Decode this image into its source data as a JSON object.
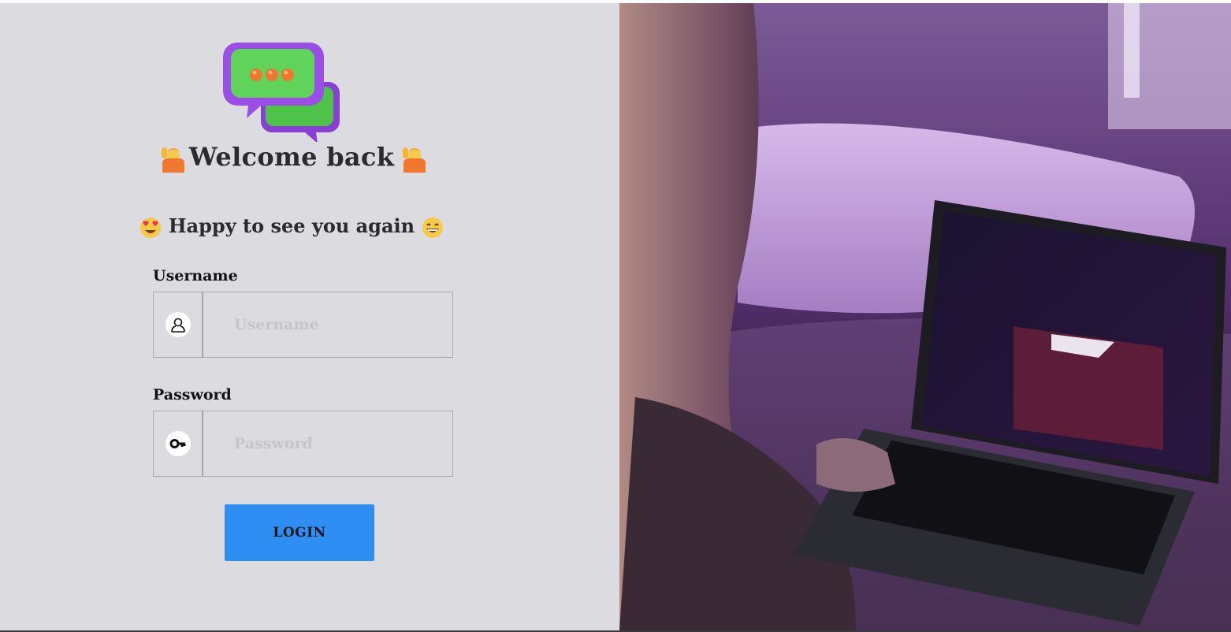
{
  "login": {
    "welcome_title": "Welcome back",
    "subtitle": "Happy to see you again",
    "username_label": "Username",
    "username_placeholder": "Username",
    "username_value": "",
    "password_label": "Password",
    "password_placeholder": "Password",
    "password_value": "",
    "login_button": "LOGIN"
  },
  "icons": {
    "logo": "chat-bubbles-icon",
    "welcome_left": "person-raising-hand-icon",
    "welcome_right": "person-raising-hand-icon",
    "subtitle_left": "heart-eyes-face-icon",
    "subtitle_right": "grinning-face-icon",
    "username": "user-icon",
    "password": "key-icon"
  },
  "colors": {
    "left_background": "#dcdbdf",
    "login_button": "#2f8ef4",
    "logo_bubble": "#9b4ee6",
    "logo_screen": "#5fd35a",
    "logo_dots": "#f0772d"
  }
}
